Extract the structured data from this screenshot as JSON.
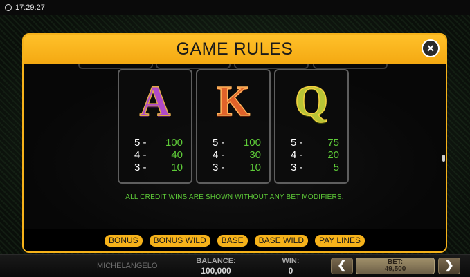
{
  "status": {
    "time": "17:29:27"
  },
  "dialog": {
    "title": "GAME RULES",
    "close_icon": "×",
    "cards": [
      {
        "symbol": "A",
        "pays": [
          {
            "count": "5 -",
            "value": "100"
          },
          {
            "count": "4 -",
            "value": "40"
          },
          {
            "count": "3 -",
            "value": "10"
          }
        ]
      },
      {
        "symbol": "K",
        "pays": [
          {
            "count": "5 -",
            "value": "100"
          },
          {
            "count": "4 -",
            "value": "30"
          },
          {
            "count": "3 -",
            "value": "10"
          }
        ]
      },
      {
        "symbol": "Q",
        "pays": [
          {
            "count": "5 -",
            "value": "75"
          },
          {
            "count": "4 -",
            "value": "20"
          },
          {
            "count": "3 -",
            "value": "5"
          }
        ]
      }
    ],
    "note": "ALL CREDIT WINS ARE SHOWN WITHOUT ANY BET MODIFIERS.",
    "tabs": [
      "BONUS",
      "BONUS WILD",
      "BASE",
      "BASE WILD",
      "PAY LINES"
    ]
  },
  "bottom": {
    "game_name": "MICHELANGELO",
    "balance_label": "BALANCE:",
    "balance_value": "100,000",
    "win_label": "WIN:",
    "win_value": "0",
    "bet_label": "BET:",
    "bet_value": "49,500",
    "prev_icon": "❮",
    "next_icon": "❯"
  },
  "colors": {
    "accent": "#f6b21a",
    "pay_value": "#5ecb38"
  }
}
